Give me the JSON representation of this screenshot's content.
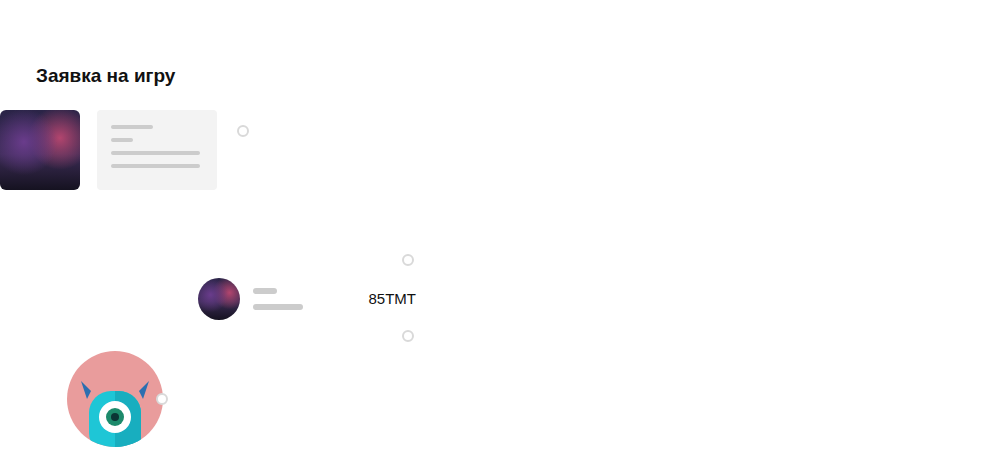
{
  "title": "Заявка на игру",
  "payment": {
    "amount": "85TMT"
  }
}
